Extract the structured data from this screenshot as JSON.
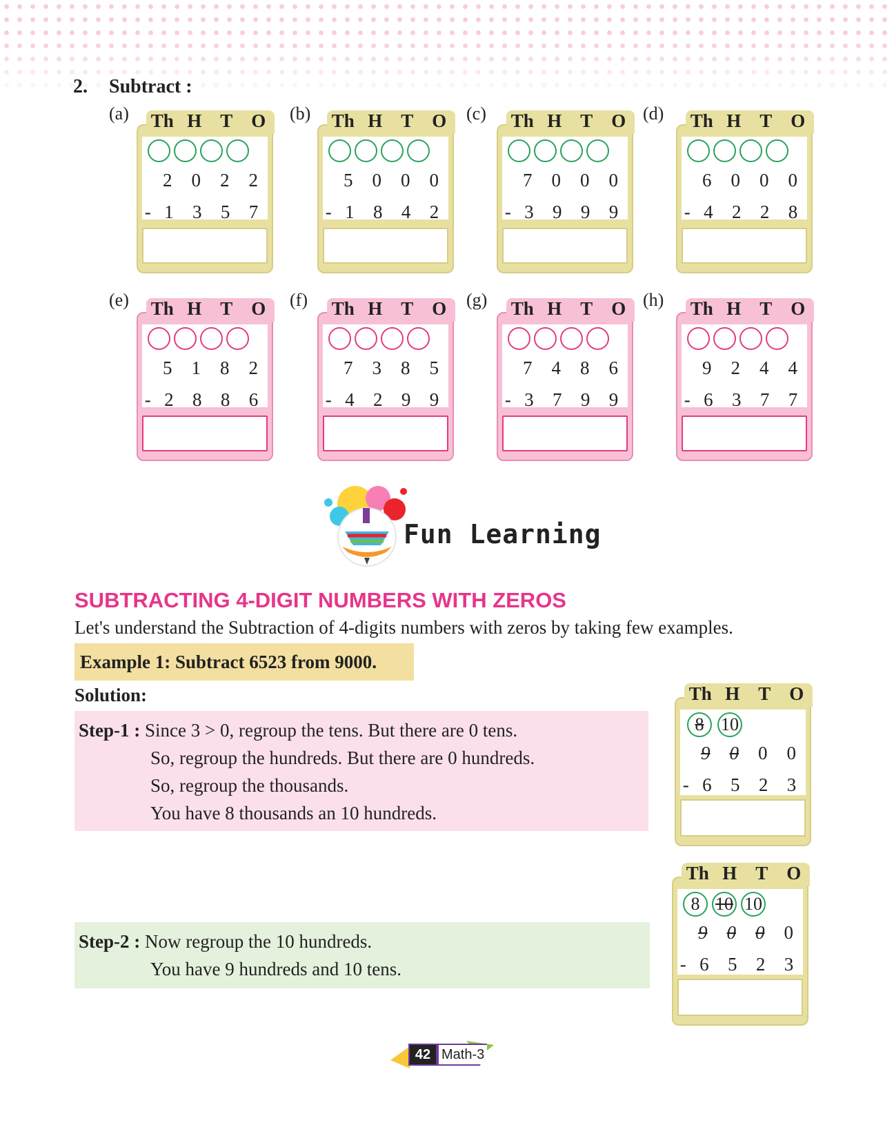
{
  "question": {
    "number": "2.",
    "title": "Subtract :"
  },
  "headers": [
    "Th",
    "H",
    "T",
    "O"
  ],
  "problems": [
    {
      "label": "(a)",
      "top": [
        "2",
        "0",
        "2",
        "2"
      ],
      "bottom": [
        "-",
        "1",
        "3",
        "5",
        "7"
      ]
    },
    {
      "label": "(b)",
      "top": [
        "5",
        "0",
        "0",
        "0"
      ],
      "bottom": [
        "-",
        "1",
        "8",
        "4",
        "2"
      ]
    },
    {
      "label": "(c)",
      "top": [
        "7",
        "0",
        "0",
        "0"
      ],
      "bottom": [
        "-",
        "3",
        "9",
        "9",
        "9"
      ]
    },
    {
      "label": "(d)",
      "top": [
        "6",
        "0",
        "0",
        "0"
      ],
      "bottom": [
        "-",
        "4",
        "2",
        "2",
        "8"
      ]
    },
    {
      "label": "(e)",
      "top": [
        "5",
        "1",
        "8",
        "2"
      ],
      "bottom": [
        "-",
        "2",
        "8",
        "8",
        "6"
      ]
    },
    {
      "label": "(f)",
      "top": [
        "7",
        "3",
        "8",
        "5"
      ],
      "bottom": [
        "-",
        "4",
        "2",
        "9",
        "9"
      ]
    },
    {
      "label": "(g)",
      "top": [
        "7",
        "4",
        "8",
        "6"
      ],
      "bottom": [
        "-",
        "3",
        "7",
        "9",
        "9"
      ]
    },
    {
      "label": "(h)",
      "top": [
        "9",
        "2",
        "4",
        "4"
      ],
      "bottom": [
        "-",
        "6",
        "3",
        "7",
        "7"
      ]
    }
  ],
  "fun_learning": "Fun Learning",
  "section_title": "SUBTRACTING 4-DIGIT NUMBERS WITH ZEROS",
  "intro": "Let's understand the Subtraction of 4-digits numbers with zeros by taking few examples.",
  "example": "Example 1: Subtract 6523 from 9000.",
  "solution": "Solution:",
  "step1": {
    "label": "Step-1 :",
    "lines": [
      "Since 3 > 0, regroup the tens. But there are 0 tens.",
      "So, regroup the hundreds. But there are 0 hundreds.",
      "So, regroup the thousands.",
      "You have 8 thousands an 10 hundreds."
    ]
  },
  "step2": {
    "label": "Step-2 :",
    "lines": [
      "Now regroup the 10 hundreds.",
      "You have 9 hundreds and 10 tens."
    ]
  },
  "example_box1": {
    "carries": [
      "8",
      "10"
    ],
    "top": [
      "9",
      "0",
      "0",
      "0"
    ],
    "bottom": [
      "-",
      "6",
      "5",
      "2",
      "3"
    ]
  },
  "example_box2": {
    "carries": [
      "8",
      "10",
      "10"
    ],
    "top": [
      "9",
      "0",
      "0",
      "0"
    ],
    "bottom": [
      "-",
      "6",
      "5",
      "2",
      "3"
    ]
  },
  "page": {
    "number": "42",
    "title": "Math-3"
  }
}
